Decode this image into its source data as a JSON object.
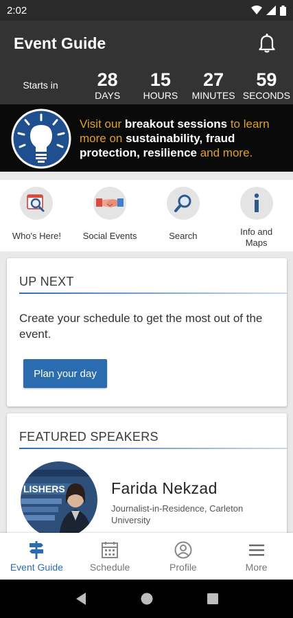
{
  "status_bar": {
    "time": "2:02"
  },
  "header": {
    "title": "Event Guide",
    "countdown": {
      "label": "Starts in",
      "units": [
        {
          "value": "28",
          "label": "DAYS"
        },
        {
          "value": "15",
          "label": "HOURS"
        },
        {
          "value": "27",
          "label": "MINUTES"
        },
        {
          "value": "59",
          "label": "SECONDS"
        }
      ]
    }
  },
  "banner": {
    "t1": "Visit our ",
    "b1": "breakout sessions",
    "t2": " to learn more on ",
    "b2": "sustainability, fraud protection, resilience",
    "t3": " and more."
  },
  "quick_links": [
    {
      "label": "Who's Here!",
      "icon": "magnifier-profile-icon"
    },
    {
      "label": "Social Events",
      "icon": "handshake-icon"
    },
    {
      "label": "Search",
      "icon": "search-icon"
    },
    {
      "label": "Info and Maps",
      "icon": "info-icon"
    }
  ],
  "up_next": {
    "title": "UP NEXT",
    "text": "Create your schedule to get the most out of the event.",
    "button_label": "Plan your day"
  },
  "featured_speakers": {
    "title": "FEATURED SPEAKERS",
    "speaker": {
      "name": "Farida Nekzad",
      "role": "Journalist-in-Residence, Carleton University"
    }
  },
  "tab_bar": {
    "items": [
      {
        "label": "Event Guide",
        "icon": "signpost-icon",
        "active": true
      },
      {
        "label": "Schedule",
        "icon": "calendar-icon",
        "active": false
      },
      {
        "label": "Profile",
        "icon": "profile-icon",
        "active": false
      },
      {
        "label": "More",
        "icon": "menu-icon",
        "active": false
      }
    ]
  },
  "colors": {
    "header_bg": "#333333",
    "accent_blue": "#2b6cb0",
    "banner_orange": "#e0a12a"
  }
}
